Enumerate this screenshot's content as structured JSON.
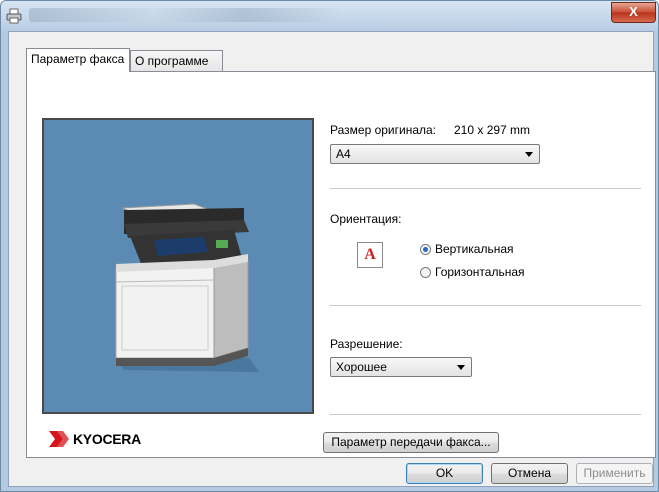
{
  "window": {
    "title": "",
    "close_label": "X",
    "accent_color": "#5b8bb2"
  },
  "tabs": [
    {
      "label": "Параметр факса",
      "active": true
    },
    {
      "label": "О программе",
      "active": false
    }
  ],
  "preview": {
    "logo_text": "KYOCERA",
    "logo_icon": "kyocera-logo-icon"
  },
  "original_size": {
    "label": "Размер оригинала:",
    "dimensions": "210 x 297 mm",
    "selected": "A4"
  },
  "orientation": {
    "label": "Ориентация:",
    "icon_glyph": "A",
    "options": [
      {
        "label": "Вертикальная",
        "checked": true
      },
      {
        "label": "Горизонтальная",
        "checked": false
      }
    ]
  },
  "resolution": {
    "label": "Разрешение:",
    "selected": "Хорошее"
  },
  "fax_settings_button": "Параметр передачи факса...",
  "buttons": {
    "ok": "OK",
    "cancel": "Отмена",
    "apply": "Применить"
  }
}
